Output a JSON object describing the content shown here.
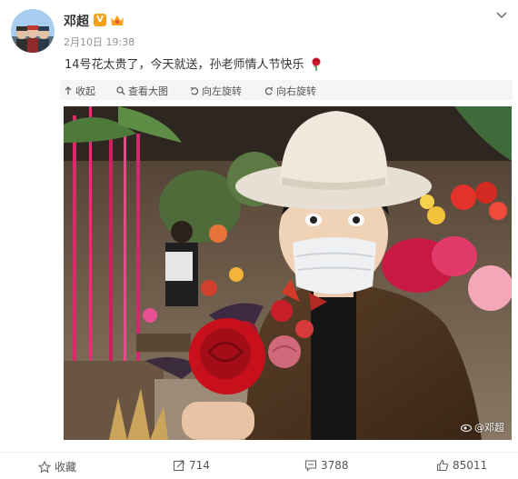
{
  "post": {
    "username": "邓超",
    "timestamp": "2月10日 19:38",
    "text": "14号花太贵了，今天就送，孙老师情人节快乐",
    "verified_badge": "V"
  },
  "image_toolbar": {
    "collapse_label": "收起",
    "view_large_label": "查看大图",
    "rotate_left_label": "向左旋转",
    "rotate_right_label": "向右旋转"
  },
  "photo": {
    "watermark": "@邓超"
  },
  "actions": {
    "favorite_label": "收藏",
    "repost_count": "714",
    "comment_count": "3788",
    "like_count": "85011"
  },
  "colors": {
    "accent_orange": "#f7a21b",
    "muted_text": "#939393",
    "toolbar_bg": "#f5f5f5"
  }
}
